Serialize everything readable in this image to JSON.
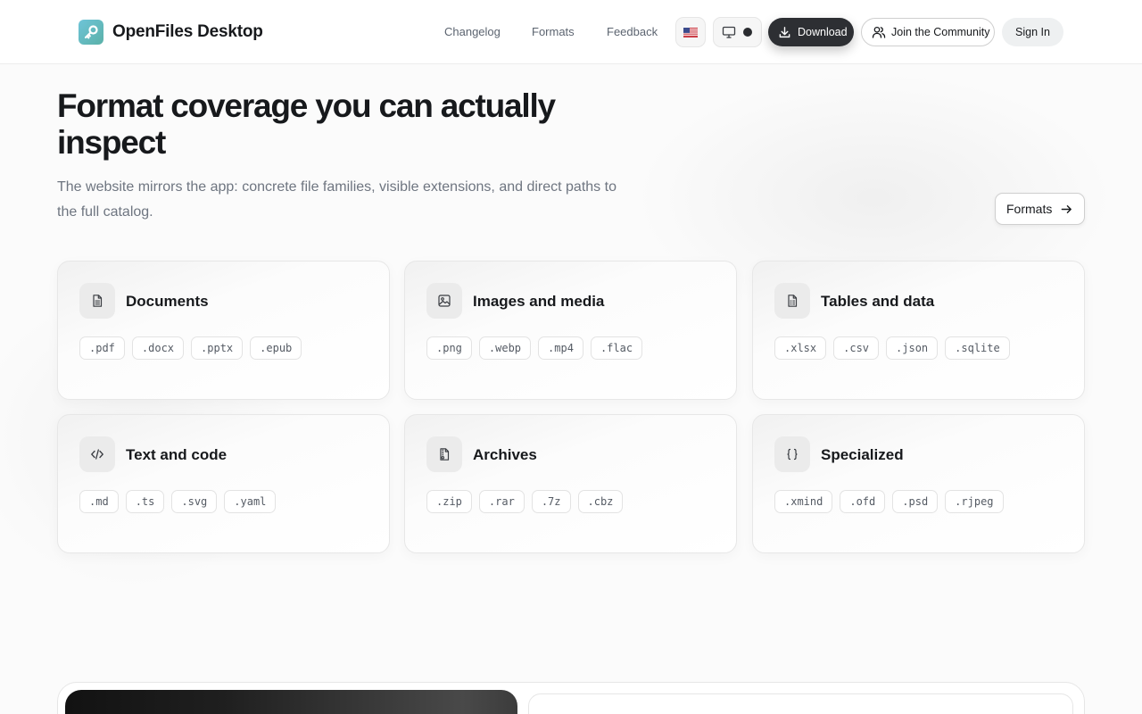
{
  "header": {
    "brand": "OpenFiles Desktop",
    "nav": [
      "Changelog",
      "Formats",
      "Feedback"
    ],
    "download_label": "Download",
    "community_label": "Join the Community",
    "signin_label": "Sign In"
  },
  "hero": {
    "title": "Format coverage you can actually inspect",
    "subtitle": "The website mirrors the app: concrete file families, visible extensions, and direct paths to the full catalog.",
    "formats_button": "Formats"
  },
  "categories": [
    {
      "title": "Documents",
      "icon": "document-icon",
      "extensions": [
        ".pdf",
        ".docx",
        ".pptx",
        ".epub"
      ]
    },
    {
      "title": "Images and media",
      "icon": "image-icon",
      "extensions": [
        ".png",
        ".webp",
        ".mp4",
        ".flac"
      ]
    },
    {
      "title": "Tables and data",
      "icon": "spreadsheet-icon",
      "extensions": [
        ".xlsx",
        ".csv",
        ".json",
        ".sqlite"
      ]
    },
    {
      "title": "Text and code",
      "icon": "code-icon",
      "extensions": [
        ".md",
        ".ts",
        ".svg",
        ".yaml"
      ]
    },
    {
      "title": "Archives",
      "icon": "archive-icon",
      "extensions": [
        ".zip",
        ".rar",
        ".7z",
        ".cbz"
      ]
    },
    {
      "title": "Specialized",
      "icon": "braces-icon",
      "extensions": [
        ".xmind",
        ".ofd",
        ".psd",
        ".rjpeg"
      ]
    }
  ],
  "colors": {
    "primary_dark": "#2d2f33",
    "text": "#17191c",
    "muted": "#6e7580",
    "logo_start": "#6ec4d8",
    "logo_end": "#5bb1a8"
  }
}
